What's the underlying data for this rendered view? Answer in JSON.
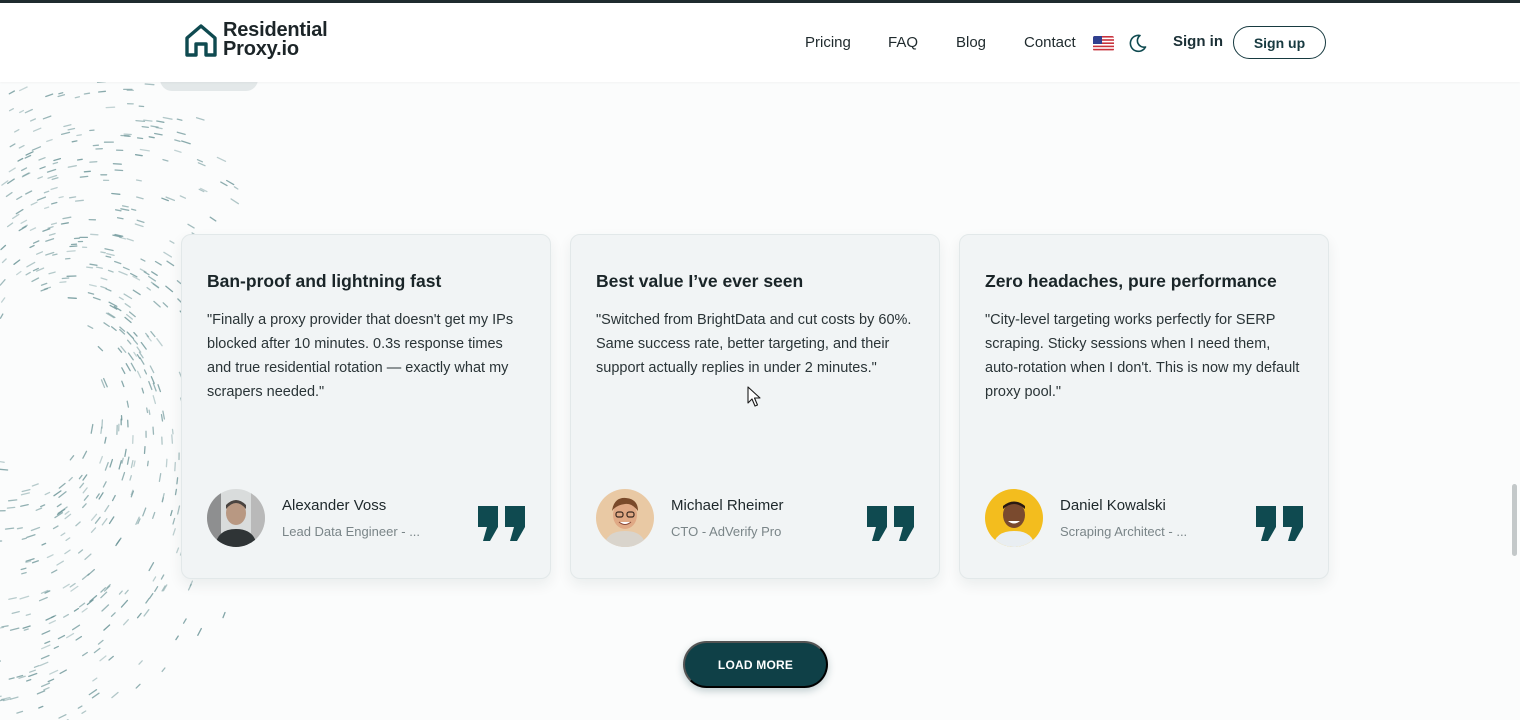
{
  "header": {
    "logo": {
      "line1": "Residential",
      "line2": "Proxy.io",
      "icon": "house-icon"
    },
    "nav": [
      {
        "label": "Pricing"
      },
      {
        "label": "FAQ"
      },
      {
        "label": "Blog"
      },
      {
        "label": "Contact"
      }
    ],
    "language_icon": "us-flag-icon",
    "theme_icon": "moon-icon",
    "signin_label": "Sign in",
    "signup_label": "Sign up"
  },
  "testimonials": [
    {
      "title": "Ban-proof and lightning fast",
      "text": "\"Finally a proxy provider that doesn't get my IPs blocked after 10 minutes. 0.3s response times and true residential rotation — exactly what my scrapers needed.\"",
      "name": "Alexander Voss",
      "role": "Lead Data Engineer - ..."
    },
    {
      "title": "Best value I’ve ever seen",
      "text": "\"Switched from BrightData and cut costs by 60%. Same success rate, better targeting, and their support actually replies in under 2 minutes.\"",
      "name": "Michael Rheimer",
      "role": "CTO - AdVerify Pro"
    },
    {
      "title": "Zero headaches, pure performance",
      "text": "\"City-level targeting works perfectly for SERP scraping. Sticky sessions when I need them, auto-rotation when I don't. This is now my default proxy pool.\"",
      "name": "Daniel Kowalski",
      "role": "Scraping Architect - ..."
    }
  ],
  "load_more_label": "LOAD MORE",
  "colors": {
    "brand_dark": "#0f4047",
    "accent_teal": "#0f4a50",
    "page_bg": "#fbfcfc",
    "card_bg": "#f1f4f5"
  }
}
